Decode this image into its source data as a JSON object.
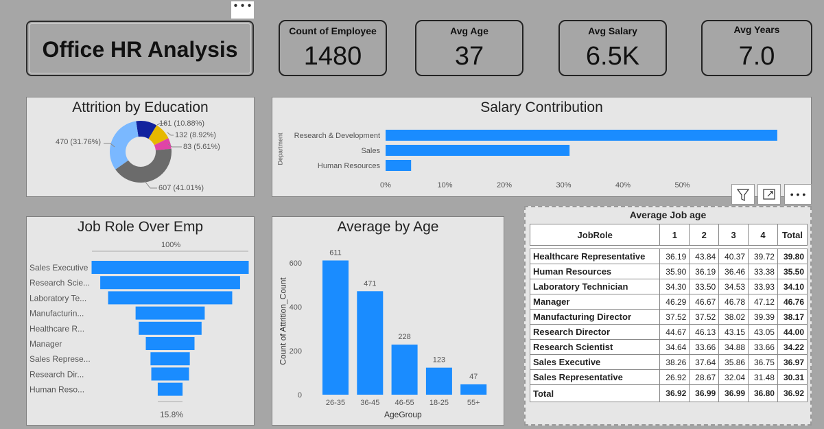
{
  "header": {
    "title": "Office HR Analysis",
    "more_glyph": "• • •"
  },
  "kpis": [
    {
      "label": "Count of Employee",
      "value": "1480"
    },
    {
      "label": "Avg Age",
      "value": "37"
    },
    {
      "label": "Avg Salary",
      "value": "6.5K"
    },
    {
      "label": "Avg Years",
      "value": "7.0"
    }
  ],
  "toolbar": {
    "filter_icon": "filter-icon",
    "focus_icon": "focus-mode-icon",
    "more_glyph": "• • •"
  },
  "colors": {
    "background": "#a6a6a6",
    "card": "#e6e6e6",
    "bar_blue": "#1a8cff",
    "donut": [
      "#118dff",
      "#12239e",
      "#e6b800",
      "#e044a7",
      "#744ec2",
      "#6b6b6b",
      "#7ab8ff"
    ]
  },
  "charts": {
    "attrition": {
      "title": "Attrition by Education",
      "labels": [
        "470 (31.76%)",
        "161 (10.88%)",
        "132 (8.92%)",
        "83 (5.61%)",
        "607 (41.01%)"
      ]
    },
    "salary": {
      "title": "Salary Contribution",
      "ylabel": "Department",
      "xticks": [
        "0%",
        "10%",
        "20%",
        "30%",
        "40%",
        "50%"
      ]
    },
    "jobrole": {
      "title": "Job Role Over Emp",
      "top_label": "100%",
      "bottom_label": "15.8%"
    },
    "age": {
      "title": "Average by Age",
      "ylabel": "Count of Attrition_Count",
      "xlabel": "AgeGroup",
      "yticks": [
        "0",
        "200",
        "400",
        "600"
      ]
    }
  },
  "chart_data": [
    {
      "type": "pie",
      "title": "Attrition by Education",
      "values": [
        470,
        161,
        132,
        83,
        607
      ],
      "percents": [
        31.76,
        10.88,
        8.92,
        5.61,
        41.01
      ],
      "colors": [
        "#7ab8ff",
        "#12239e",
        "#e6b800",
        "#e044a7",
        "#6b6b6b"
      ],
      "donut": true
    },
    {
      "type": "bar",
      "orientation": "horizontal",
      "title": "Salary Contribution",
      "ylabel": "Department",
      "categories": [
        "Research & Development",
        "Sales",
        "Human Resources"
      ],
      "values": [
        66,
        31,
        4.3
      ],
      "xlim": [
        0,
        60
      ],
      "xticks": [
        0,
        10,
        20,
        30,
        40,
        50
      ]
    },
    {
      "type": "bar",
      "orientation": "funnel",
      "title": "Job Role Over Emp",
      "categories": [
        "Sales Executive",
        "Research Scie...",
        "Laboratory Te...",
        "Manufacturin...",
        "Healthcare R...",
        "Manager",
        "Sales Represe...",
        "Research Dir...",
        "Human Reso..."
      ],
      "values": [
        100,
        89,
        79,
        44,
        40,
        31,
        25,
        24,
        15.8
      ]
    },
    {
      "type": "bar",
      "title": "Average by Age",
      "xlabel": "AgeGroup",
      "ylabel": "Count of Attrition_Count",
      "categories": [
        "26-35",
        "36-45",
        "46-55",
        "18-25",
        "55+"
      ],
      "values": [
        611,
        471,
        228,
        123,
        47
      ],
      "ylim": [
        0,
        650
      ],
      "yticks": [
        0,
        200,
        400,
        600
      ]
    }
  ],
  "table": {
    "title": "Average Job age",
    "columns": [
      "JobRole",
      "1",
      "2",
      "3",
      "4",
      "Total"
    ],
    "rows": [
      [
        "Healthcare Representative",
        "36.19",
        "43.84",
        "40.37",
        "39.72",
        "39.80"
      ],
      [
        "Human Resources",
        "35.90",
        "36.19",
        "36.46",
        "33.38",
        "35.50"
      ],
      [
        "Laboratory Technician",
        "34.30",
        "33.50",
        "34.53",
        "33.93",
        "34.10"
      ],
      [
        "Manager",
        "46.29",
        "46.67",
        "46.78",
        "47.12",
        "46.76"
      ],
      [
        "Manufacturing Director",
        "37.52",
        "37.52",
        "38.02",
        "39.39",
        "38.17"
      ],
      [
        "Research Director",
        "44.67",
        "46.13",
        "43.15",
        "43.05",
        "44.00"
      ],
      [
        "Research Scientist",
        "34.64",
        "33.66",
        "34.88",
        "33.66",
        "34.22"
      ],
      [
        "Sales Executive",
        "38.26",
        "37.64",
        "35.86",
        "36.75",
        "36.97"
      ],
      [
        "Sales Representative",
        "26.92",
        "28.67",
        "32.04",
        "31.48",
        "30.31"
      ]
    ],
    "total": [
      "Total",
      "36.92",
      "36.99",
      "36.99",
      "36.80",
      "36.92"
    ]
  }
}
